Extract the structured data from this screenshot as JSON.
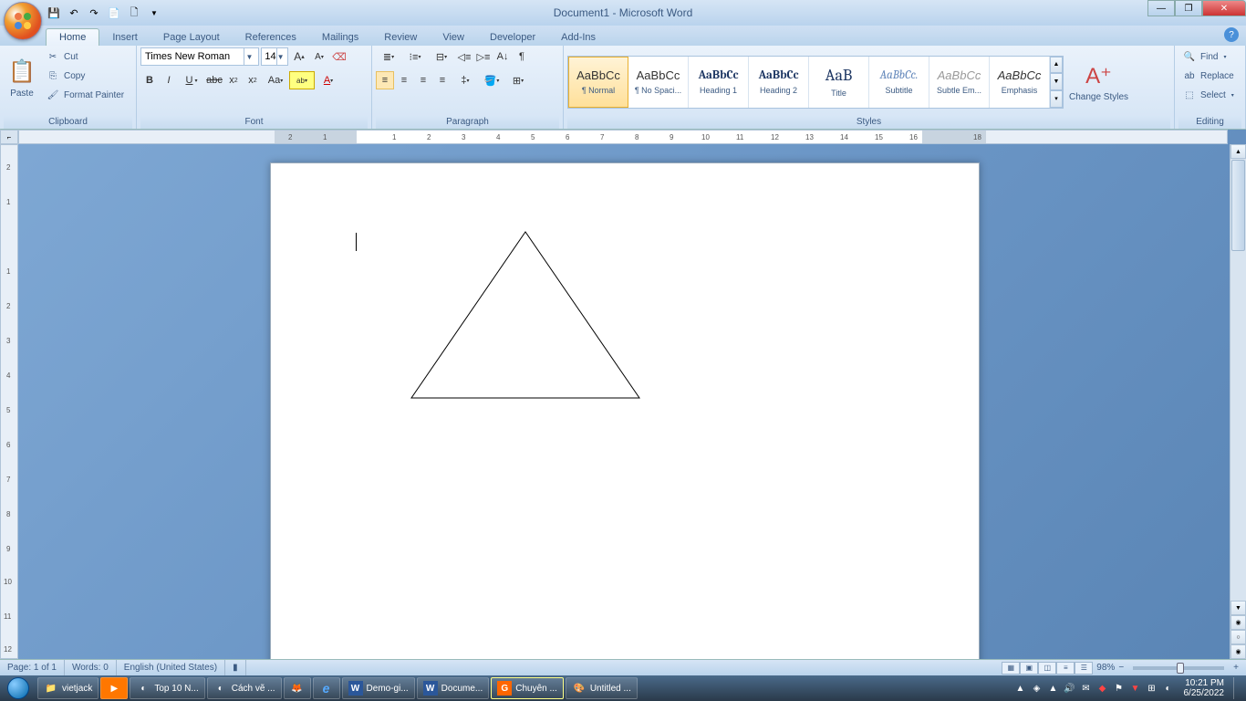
{
  "title": "Document1 - Microsoft Word",
  "tabs": {
    "home": "Home",
    "insert": "Insert",
    "page_layout": "Page Layout",
    "references": "References",
    "mailings": "Mailings",
    "review": "Review",
    "view": "View",
    "developer": "Developer",
    "addins": "Add-Ins"
  },
  "clipboard": {
    "label": "Clipboard",
    "paste": "Paste",
    "cut": "Cut",
    "copy": "Copy",
    "format_painter": "Format Painter"
  },
  "font": {
    "label": "Font",
    "name": "Times New Roman",
    "size": "14"
  },
  "paragraph": {
    "label": "Paragraph"
  },
  "styles": {
    "label": "Styles",
    "change": "Change Styles",
    "items": [
      {
        "preview": "AaBbCc",
        "name": "¶ Normal"
      },
      {
        "preview": "AaBbCc",
        "name": "¶ No Spaci..."
      },
      {
        "preview": "AaBbCc",
        "name": "Heading 1"
      },
      {
        "preview": "AaBbCc",
        "name": "Heading 2"
      },
      {
        "preview": "AaB",
        "name": "Title"
      },
      {
        "preview": "AaBbCc.",
        "name": "Subtitle"
      },
      {
        "preview": "AaBbCc",
        "name": "Subtle Em..."
      },
      {
        "preview": "AaBbCc",
        "name": "Emphasis"
      }
    ]
  },
  "editing": {
    "label": "Editing",
    "find": "Find",
    "replace": "Replace",
    "select": "Select"
  },
  "status": {
    "page": "Page: 1 of 1",
    "words": "Words: 0",
    "lang": "English (United States)",
    "zoom": "98%"
  },
  "taskbar": {
    "items": [
      {
        "label": "vietjack",
        "icon": "📁",
        "bg": ""
      },
      {
        "label": "",
        "icon": "▶",
        "bg": "#ff7700"
      },
      {
        "label": "Top 10 N...",
        "icon": "◐",
        "bg": ""
      },
      {
        "label": "Cách vẽ ...",
        "icon": "◐",
        "bg": ""
      },
      {
        "label": "",
        "icon": "🦊",
        "bg": ""
      },
      {
        "label": "",
        "icon": "e",
        "bg": "#0078d7"
      },
      {
        "label": "Demo-gi...",
        "icon": "W",
        "bg": "#2b579a"
      },
      {
        "label": "Docume...",
        "icon": "W",
        "bg": "#2b579a"
      },
      {
        "label": "Chuyên ...",
        "icon": "G",
        "bg": "#ff6600"
      },
      {
        "label": "Untitled ...",
        "icon": "🎨",
        "bg": ""
      }
    ],
    "time": "10:21 PM",
    "date": "6/25/2022"
  }
}
